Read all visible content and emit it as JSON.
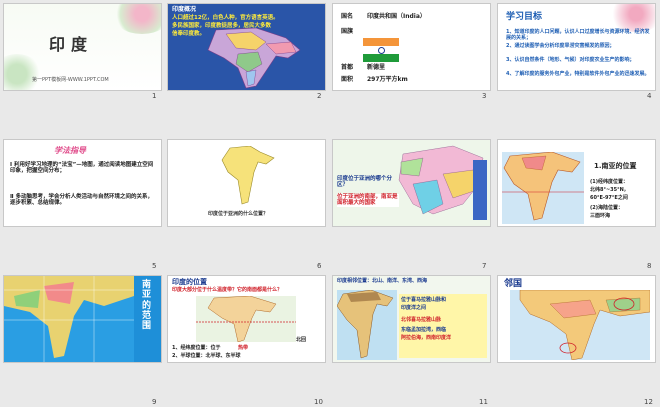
{
  "site": "第一PPT模板网-WWW.1PPT.COM",
  "slides": [
    {
      "n": "1",
      "title": "印度",
      "footer": "第一PPT模板网-WWW.1PPT.COM"
    },
    {
      "n": "2",
      "heading": "印度概况",
      "line1": "人口超过12亿，白色人种，官方语言英语。",
      "line2": "多民族国家，印度教徒居多，居民大多数",
      "line3": "信奉印度教。"
    },
    {
      "n": "3",
      "country_label": "国名",
      "country_value": "印度共和国（India）",
      "flag_label": "国旗",
      "capital_label": "首都",
      "capital_value": "新德里",
      "area_label": "面积",
      "area_value": "297万平方km"
    },
    {
      "n": "4",
      "title": "学习目标",
      "items": [
        "1、知道印度的人口问题，认识人口过度增长与资源环境、经济发展的关系；",
        "2、通过读图学会分析印度旱涝灾害频发的原因；",
        "3、认识自然条件（地形、气候）对印度农业生产的影响；",
        "4、了解印度的服务外包产业，特别是软件外包产业的迅速发展。"
      ]
    },
    {
      "n": "5",
      "title": "学法指导",
      "p1": "Ⅰ 利用好学习地理的“法宝”—地图，通过阅读地图建立空间印象，把握空间分布；",
      "p2": "Ⅱ 多动脑思考，学会分析人类活动与自然环境之间的关系，逐步积累、总结规律。"
    },
    {
      "n": "6",
      "caption": "印度位于亚洲的什么位置？"
    },
    {
      "n": "7",
      "q": "印度位于亚洲的哪个分区？",
      "a": "位于亚洲的南部，南亚是面积最大的国家"
    },
    {
      "n": "8",
      "title": "1.南亚的位置",
      "l1": "(1)经纬度位置：",
      "l2": "北纬8°~35°N，",
      "l3": "60°E-97°E之间",
      "l4": "(2)海陆位置：",
      "l5": "三面环海"
    },
    {
      "n": "9",
      "title": "南亚的范围"
    },
    {
      "n": "10",
      "title": "印度的位置",
      "sub": "印度大部分位于什么温度带？它的南面都是什么？",
      "l1": "1、经纬度位置：位于",
      "l1b": "热带",
      "l2": "2、半球位置：北半球、东半球",
      "north": "北回"
    },
    {
      "n": "11",
      "heading": "印度相邻位置：北山、南洋、东湾、西海",
      "b1": "位于喜马拉雅山脉和",
      "b2": "印度洋之间",
      "b3": "北邻喜马拉雅山脉",
      "b4": "东临孟加拉湾，西临",
      "b5": "阿拉伯海，西南印度洋"
    },
    {
      "n": "12",
      "title": "邻国"
    }
  ]
}
